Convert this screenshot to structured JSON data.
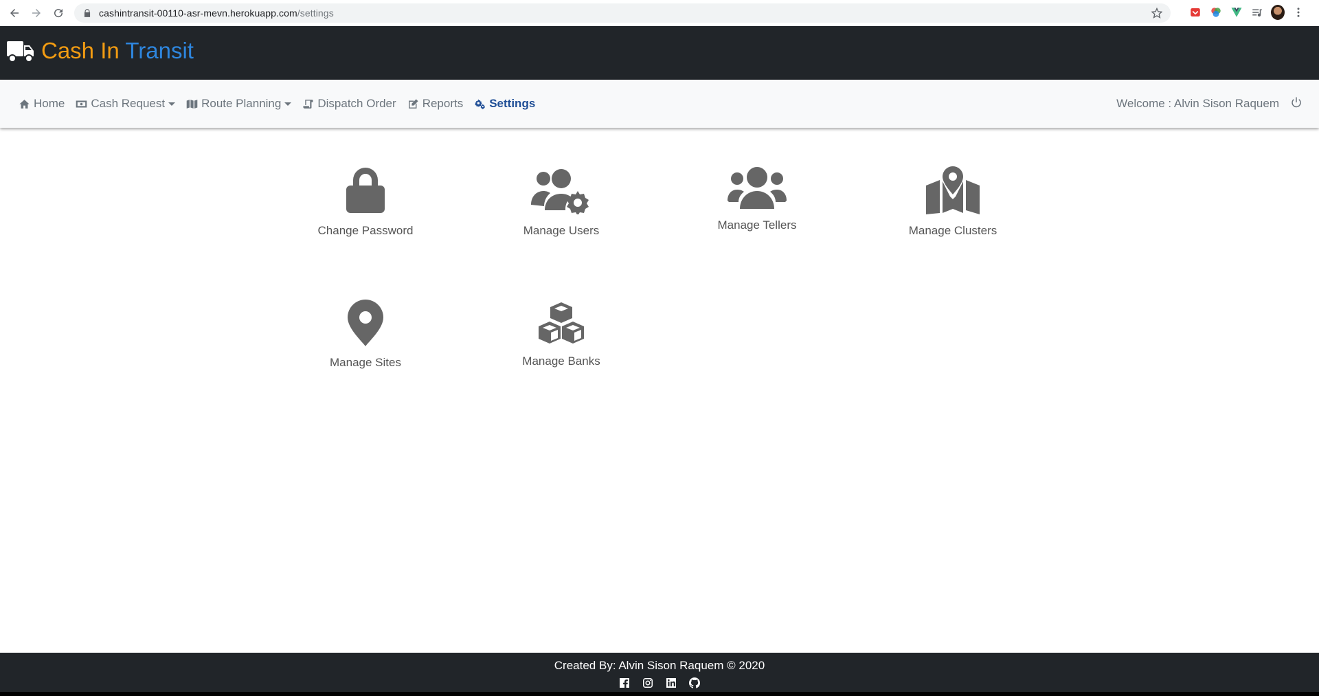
{
  "browser": {
    "url_host": "cashintransit-00110-asr-mevn.herokuapp.com",
    "url_path": "/settings"
  },
  "brand": {
    "part1": "Cash In",
    "part2": "Transit",
    "color1": "#f39c12",
    "color2": "#2e86de"
  },
  "nav": {
    "items": [
      {
        "label": "Home",
        "icon": "home-icon"
      },
      {
        "label": "Cash Request",
        "icon": "money-bill-icon",
        "dropdown": true
      },
      {
        "label": "Route Planning",
        "icon": "map-icon",
        "dropdown": true
      },
      {
        "label": "Dispatch Order",
        "icon": "scroll-icon"
      },
      {
        "label": "Reports",
        "icon": "edit-icon"
      },
      {
        "label": "Settings",
        "icon": "cogs-icon",
        "active": true
      }
    ],
    "welcome": "Welcome : Alvin Sison Raquem",
    "active_color": "#1f4e96"
  },
  "tiles": [
    {
      "label": "Change Password",
      "icon": "lock-icon"
    },
    {
      "label": "Manage Users",
      "icon": "users-cog-icon"
    },
    {
      "label": "Manage Tellers",
      "icon": "users-icon"
    },
    {
      "label": "Manage Clusters",
      "icon": "map-marked-icon"
    },
    {
      "label": "Manage Sites",
      "icon": "map-marker-icon"
    },
    {
      "label": "Manage Banks",
      "icon": "cubes-icon"
    }
  ],
  "footer": {
    "credit": "Created By: Alvin Sison Raquem © 2020",
    "socials": [
      "facebook-icon",
      "instagram-icon",
      "linkedin-icon",
      "github-icon"
    ]
  }
}
